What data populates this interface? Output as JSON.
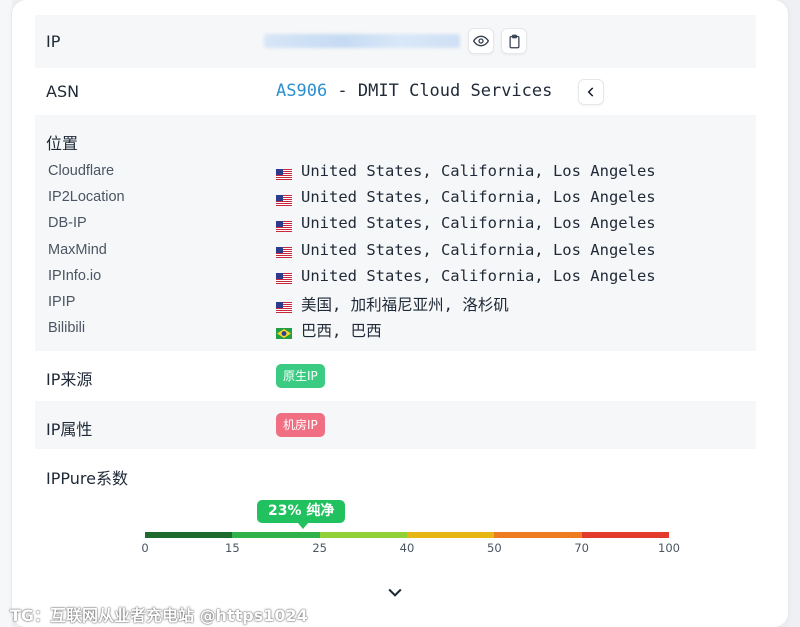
{
  "ip": {
    "label": "IP",
    "reveal_icon": "eye-icon",
    "copy_icon": "clipboard-icon"
  },
  "asn": {
    "label": "ASN",
    "code": "AS906",
    "separator": " - ",
    "name": "DMIT Cloud Services",
    "collapse_icon": "chevron-left-icon"
  },
  "location": {
    "label": "位置",
    "items": [
      {
        "source": "Cloudflare",
        "flag": "us-flag-icon",
        "value": "United States, California, Los Angeles"
      },
      {
        "source": "IP2Location",
        "flag": "us-flag-icon",
        "value": "United States, California, Los Angeles"
      },
      {
        "source": "DB-IP",
        "flag": "us-flag-icon",
        "value": "United States, California, Los Angeles"
      },
      {
        "source": "MaxMind",
        "flag": "us-flag-icon",
        "value": "United States, California, Los Angeles"
      },
      {
        "source": "IPInfo.io",
        "flag": "us-flag-icon",
        "value": "United States, California, Los Angeles"
      },
      {
        "source": "IPIP",
        "flag": "us-flag-icon",
        "value": "美国, 加利福尼亚州, 洛杉矶"
      },
      {
        "source": "Bilibili",
        "flag": "br-flag-icon",
        "value": "巴西, 巴西"
      }
    ]
  },
  "ip_source": {
    "label": "IP来源",
    "badge": "原生IP",
    "badge_color": "#3ccb83"
  },
  "ip_attribute": {
    "label": "IP属性",
    "badge": "机房IP",
    "badge_color": "#f06f82"
  },
  "score": {
    "label": "IPPure系数",
    "value_percent": 23,
    "tooltip": "23% 纯净",
    "ticks": [
      "0",
      "15",
      "25",
      "40",
      "50",
      "70",
      "100"
    ],
    "segment_colors": [
      "#1e6b2e",
      "#2fb24a",
      "#8fd136",
      "#e6b712",
      "#ee7d22",
      "#e23b2b"
    ]
  },
  "expand_icon": "chevron-down-icon",
  "watermark": "TG：互联网从业者充电站 @https1024"
}
